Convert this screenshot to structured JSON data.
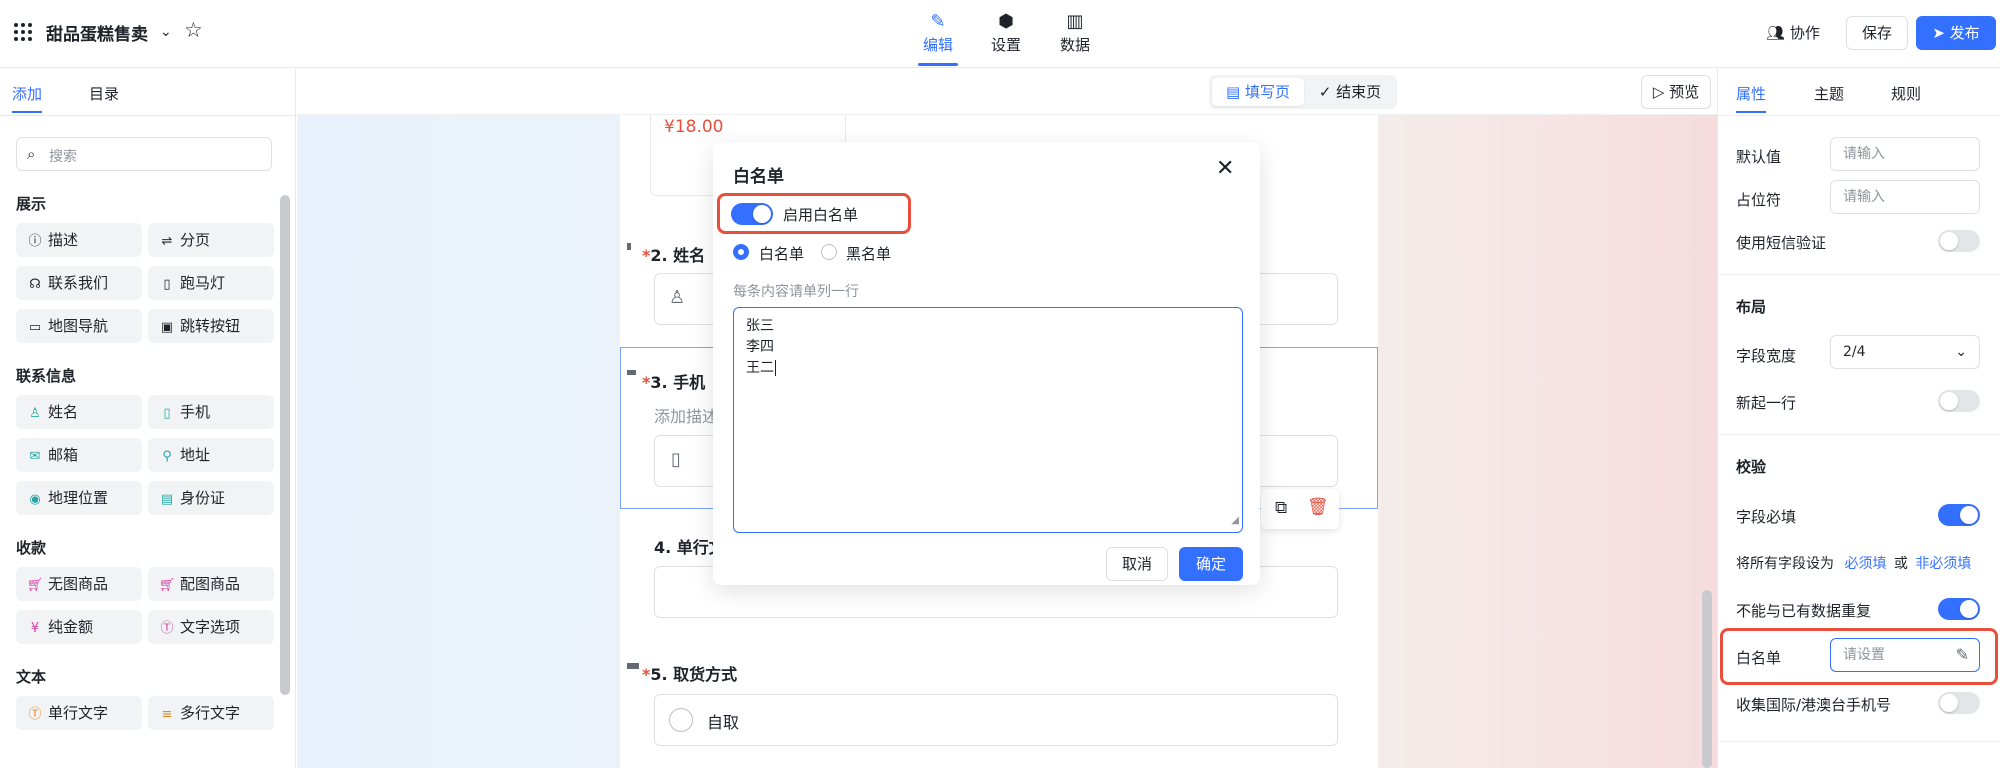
{
  "topbar": {
    "app_title": "甜品蛋糕售卖",
    "tabs": [
      {
        "label": "编辑",
        "icon": "pen-icon"
      },
      {
        "label": "设置",
        "icon": "hexagon-icon"
      },
      {
        "label": "数据",
        "icon": "bar-chart-icon"
      }
    ],
    "collab_label": "协作",
    "save_label": "保存",
    "publish_label": "发布"
  },
  "left": {
    "tabs": [
      "添加",
      "目录"
    ],
    "search_placeholder": "搜索",
    "sections": [
      {
        "title": "展示",
        "items": [
          {
            "label": "描述",
            "icon": "info-icon"
          },
          {
            "label": "分页",
            "icon": "page-break-icon"
          },
          {
            "label": "联系我们",
            "icon": "headset-icon"
          },
          {
            "label": "跑马灯",
            "icon": "carousel-icon"
          },
          {
            "label": "地图导航",
            "icon": "map-icon"
          },
          {
            "label": "跳转按钮",
            "icon": "button-icon"
          }
        ]
      },
      {
        "title": "联系信息",
        "items": [
          {
            "label": "姓名",
            "icon": "user-icon"
          },
          {
            "label": "手机",
            "icon": "phone-icon"
          },
          {
            "label": "邮箱",
            "icon": "mail-icon"
          },
          {
            "label": "地址",
            "icon": "location-icon"
          },
          {
            "label": "地理位置",
            "icon": "pin-icon"
          },
          {
            "label": "身份证",
            "icon": "id-card-icon"
          }
        ]
      },
      {
        "title": "收款",
        "items": [
          {
            "label": "无图商品",
            "icon": "cart-icon"
          },
          {
            "label": "配图商品",
            "icon": "cart-image-icon"
          },
          {
            "label": "纯金额",
            "icon": "yen-icon"
          },
          {
            "label": "文字选项",
            "icon": "text-option-icon"
          }
        ]
      },
      {
        "title": "文本",
        "items": [
          {
            "label": "单行文字",
            "icon": "single-line-icon"
          },
          {
            "label": "多行文字",
            "icon": "multi-line-icon"
          }
        ]
      }
    ]
  },
  "subbar": {
    "fill_page": "填写页",
    "end_page": "结束页",
    "preview": "预览"
  },
  "form": {
    "price": "¥18.00",
    "q2": "2. 姓名",
    "q3": "3. 手机",
    "q3_desc": "添加描述",
    "q4": "4. 单行文",
    "q5": "5. 取货方式",
    "q5_option": "自取",
    "required_mark": "*"
  },
  "modal": {
    "title": "白名单",
    "enable_label": "启用白名单",
    "radio_whitelist": "白名单",
    "radio_blacklist": "黑名单",
    "hint": "每条内容请单列一行",
    "entries": [
      "张三",
      "李四",
      "王二"
    ],
    "cancel": "取消",
    "confirm": "确定"
  },
  "right": {
    "tabs": [
      "属性",
      "主题",
      "规则"
    ],
    "default_label": "默认值",
    "default_placeholder": "请输入",
    "placeholder_label": "占位符",
    "placeholder_placeholder": "请输入",
    "sms_label": "使用短信验证",
    "layout_title": "布局",
    "width_label": "字段宽度",
    "width_value": "2/4",
    "newline_label": "新起一行",
    "validate_title": "校验",
    "required_label": "字段必填",
    "set_all_label": "将所有字段设为",
    "set_required": "必须填",
    "or": "或",
    "set_optional": "非必须填",
    "no_dup_label": "不能与已有数据重复",
    "whitelist_label": "白名单",
    "whitelist_placeholder": "请设置",
    "intl_phone_label": "收集国际/港澳台手机号"
  },
  "colors": {
    "accent": "#3370ff",
    "highlight": "#e6503c",
    "required": "#e6503c"
  }
}
